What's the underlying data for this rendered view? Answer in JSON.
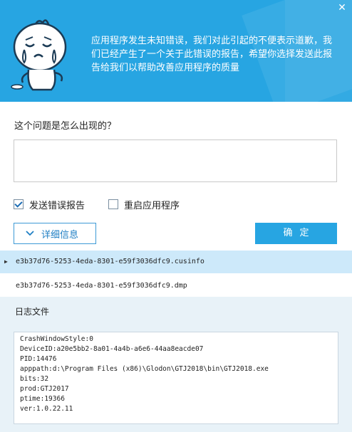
{
  "header": {
    "message": "应用程序发生未知错误，我们对此引起的不便表示道歉，我们已经产生了一个关于此错误的报告，希望你选择发送此报告给我们以帮助改善应用程序的质量",
    "close_icon": "close-icon",
    "bg_color": "#27a5e2"
  },
  "question": {
    "label": "这个问题是怎么出现的？",
    "value": ""
  },
  "options": {
    "send_report": {
      "label": "发送错误报告",
      "checked": true
    },
    "restart_app": {
      "label": "重启应用程序",
      "checked": false
    }
  },
  "buttons": {
    "details_label": "详细信息",
    "ok_label": "确定"
  },
  "files": [
    {
      "name": "e3b37d76-5253-4eda-8301-e59f3036dfc9.cusinfo",
      "selected": true
    },
    {
      "name": "e3b37d76-5253-4eda-8301-e59f3036dfc9.dmp",
      "selected": false
    }
  ],
  "log": {
    "title": "日志文件",
    "lines": [
      "CrashWindowStyle:0",
      "DeviceID:a20e5bb2-8a01-4a4b-a6e6-44aa8eacde07",
      "PID:14476",
      "apppath:d:\\Program Files (x86)\\Glodon\\GTJ2018\\bin\\GTJ2018.exe",
      "bits:32",
      "prod:GTJ2017",
      "ptime:19366",
      "ver:1.0.22.11"
    ]
  }
}
